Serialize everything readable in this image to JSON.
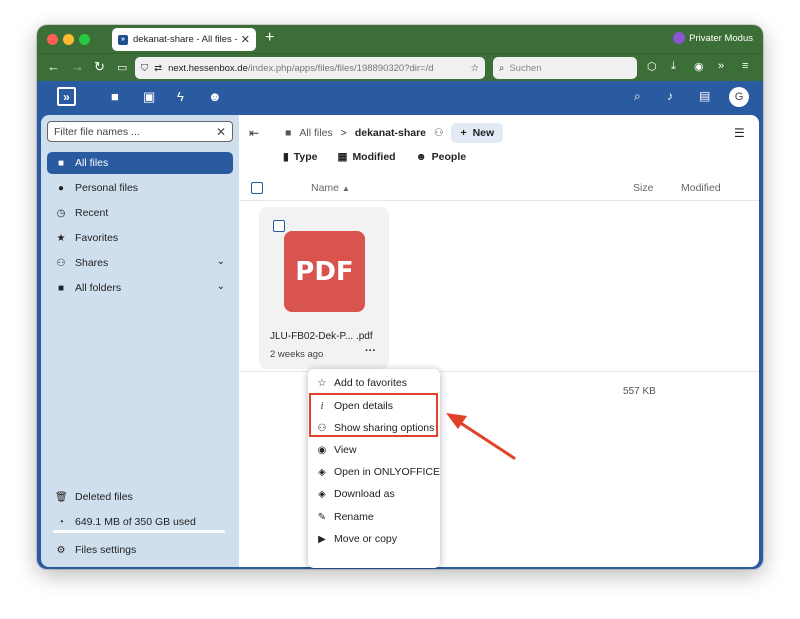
{
  "browser": {
    "tab_title": "dekanat-share - All files - Files",
    "tab_close": "✕",
    "new_tab": "+",
    "private_mode": "Privater Modus",
    "url_host": "next.hessenbox.de",
    "url_path": "/index.php/apps/files/files/198890320?dir=/d",
    "search_placeholder": "Suchen"
  },
  "header": {
    "avatar_letter": "G"
  },
  "sidebar": {
    "filter_placeholder": "Filter file names ...",
    "items": [
      {
        "label": "All files",
        "icon": "folder-icon"
      },
      {
        "label": "Personal files",
        "icon": "person-icon"
      },
      {
        "label": "Recent",
        "icon": "history-icon"
      },
      {
        "label": "Favorites",
        "icon": "star-icon"
      },
      {
        "label": "Shares",
        "icon": "share-icon"
      },
      {
        "label": "All folders",
        "icon": "folder-icon"
      }
    ],
    "deleted_files": "Deleted files",
    "quota": "649.1 MB of 350 GB used",
    "settings": "Files settings"
  },
  "breadcrumb": {
    "root": "All files",
    "separator": ">",
    "current": "dekanat-share",
    "new_button": "New"
  },
  "filters": {
    "type": "Type",
    "modified": "Modified",
    "people": "People"
  },
  "list_header": {
    "name": "Name",
    "size": "Size",
    "modified": "Modified"
  },
  "file": {
    "name": "JLU-FB02-Dek-P... .pdf",
    "date": "2 weeks ago",
    "icon_text": "PDF",
    "size": "557 KB"
  },
  "context_menu": {
    "items": [
      {
        "label": "Add to favorites",
        "icon": "star-icon"
      },
      {
        "label": "Open details",
        "icon": "info-icon"
      },
      {
        "label": "Show sharing options",
        "icon": "share-user-icon"
      },
      {
        "label": "View",
        "icon": "eye-icon"
      },
      {
        "label": "Open in ONLYOFFICE",
        "icon": "layers-icon"
      },
      {
        "label": "Download as",
        "icon": "layers-icon"
      },
      {
        "label": "Rename",
        "icon": "pencil-icon"
      },
      {
        "label": "Move or copy",
        "icon": "folder-move-icon"
      }
    ],
    "highlight_color": "#e0432a"
  },
  "colors": {
    "browser_chrome": "#3c6e38",
    "nextcloud_primary": "#2a5aa0",
    "sidebar_bg": "#d0dfee",
    "pdf_red": "#d9534f"
  }
}
